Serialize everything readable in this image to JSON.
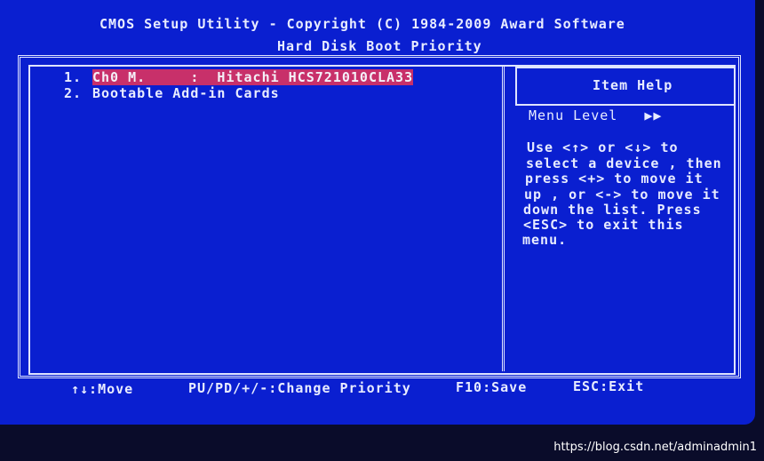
{
  "header": {
    "title": "CMOS Setup Utility - Copyright (C) 1984-2009 Award Software",
    "subtitle": "Hard Disk Boot Priority"
  },
  "items": [
    {
      "index": "1.",
      "label": "Ch0 M.     :  Hitachi HCS721010CLA33",
      "selected": true
    },
    {
      "index": "2.",
      "label": "Bootable Add-in Cards",
      "selected": false
    }
  ],
  "help": {
    "title": "Item Help",
    "menu_level": "Menu Level   ▶▶",
    "lines": [
      "Use <↑> or <↓> to",
      "select a device , then",
      "press <+> to move it",
      "up , or <-> to move it",
      "down the list. Press",
      "<ESC> to exit this",
      "menu."
    ]
  },
  "footer": {
    "move": "↑↓:Move",
    "change": "PU/PD/+/-:Change Priority",
    "save": "F10:Save",
    "exit": "ESC:Exit"
  },
  "watermark": "https://blog.csdn.net/adminadmin1",
  "colors": {
    "background": "#0a1fd0",
    "highlight": "#c8306a",
    "text": "#e8ecff"
  }
}
